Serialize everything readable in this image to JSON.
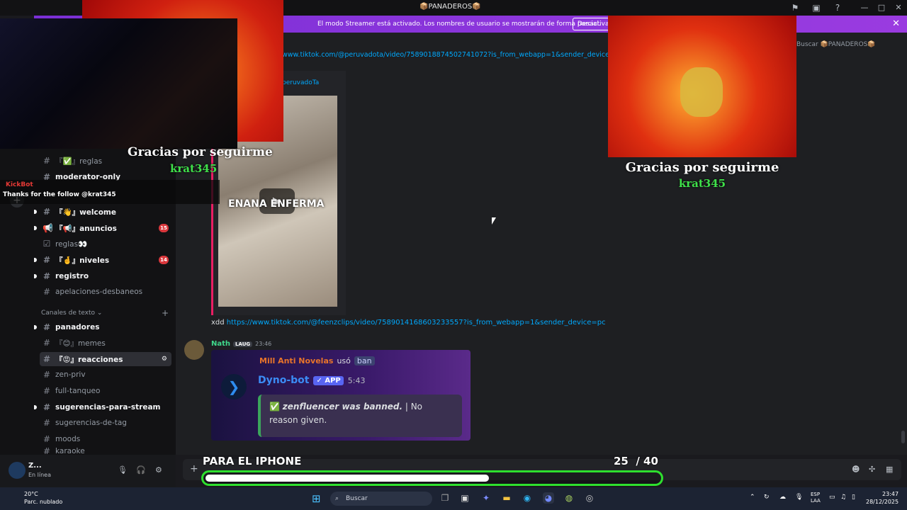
{
  "window": {
    "title": "📦PANADEROS📦"
  },
  "streamer_banner": {
    "text": "El modo Streamer está activado. Los nombres de usuario se mostrarán de forma parcial.",
    "button": "Desactivar"
  },
  "search": {
    "placeholder": "Buscar 📦PANADEROS📦"
  },
  "sidebar": {
    "channels": [
      {
        "name": "『✅』reglas",
        "unread": false
      },
      {
        "name": "moderator-only",
        "unread": true
      },
      {
        "name": "『👋』welcome",
        "unread": true
      },
      {
        "name": "『📢』anuncios",
        "unread": true,
        "badge": "15"
      },
      {
        "name": "reglas👀",
        "unread": false
      },
      {
        "name": "『🤞』niveles",
        "unread": true,
        "badge": "14"
      },
      {
        "name": "registro",
        "unread": true
      },
      {
        "name": "apelaciones-desbaneos",
        "unread": false
      }
    ],
    "category": "Canales de texto",
    "text_channels": [
      {
        "name": "panadores",
        "unread": true
      },
      {
        "name": "『😊』memes",
        "unread": false
      },
      {
        "name": "『😡』reacciones",
        "unread": true,
        "active": true
      },
      {
        "name": "zen-priv",
        "unread": false
      },
      {
        "name": "full-tanqueo",
        "unread": false
      },
      {
        "name": "sugerencias-para-stream",
        "unread": true
      },
      {
        "name": "sugerencias-de-tag",
        "unread": false
      },
      {
        "name": "moods",
        "unread": false
      },
      {
        "name": "karaoke",
        "unread": false
      }
    ]
  },
  "user": {
    "name": "Z...",
    "status": "En línea"
  },
  "messages": {
    "top_link": "www.tiktok.com/@peruvadota/video/7589018874502741072?is_from_webapp=1&sender_device=pc",
    "embed_author": "peruvadoTa",
    "video_label": "ENANA ENFERMA",
    "xdd_prefix": "xdd ",
    "xdd_link": "https://www.tiktok.com/@feenzclips/video/7589014168603233557?is_from_webapp=1&sender_device=pc",
    "author": "Nath",
    "tag": "LAUG",
    "time": "23:46",
    "dyno": {
      "reply_name": "Mill Anti Novelas",
      "reply_used": "usó",
      "reply_cmd": "ban",
      "bot_name": "Dyno-bot",
      "app_tag": "✓ APP",
      "bot_time": "5:43",
      "ban_user": "zenfluencer was banned.",
      "ban_reason": " | No reason given."
    }
  },
  "overlay": {
    "alert_title": "Gracias por seguirme",
    "alert_user": "krat345",
    "kickbot_name": "KickBot",
    "kickbot_msg": "Thanks for the follow @krat345",
    "goal_label": "PARA EL IPHONE",
    "goal_current": "25",
    "goal_total": "/ 40",
    "goal_progress": 0.625
  },
  "taskbar": {
    "weather_temp": "20°C",
    "weather_desc": "Parc. nublado",
    "search": "Buscar",
    "lang1": "ESP",
    "lang2": "LAA",
    "time": "23:47",
    "date": "28/12/2025"
  },
  "colors": {
    "streamer": "#8a2be2",
    "goal_border": "#2ee02e",
    "accent_link": "#00a8fc"
  }
}
